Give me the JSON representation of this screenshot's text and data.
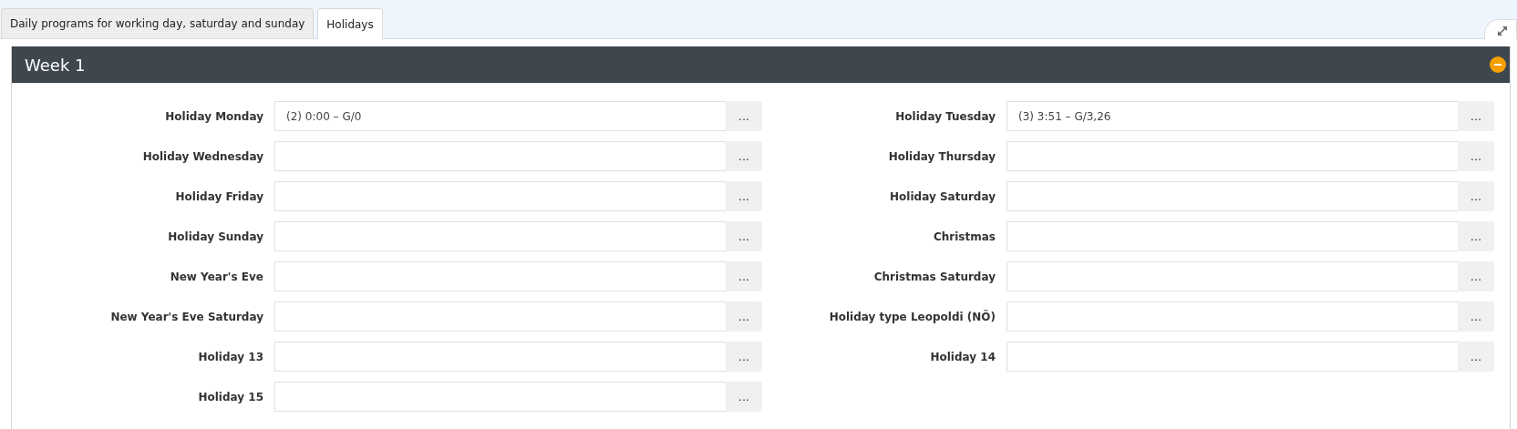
{
  "tabs": [
    {
      "label": "Daily programs for working day, saturday and sunday",
      "selected": false
    },
    {
      "label": "Holidays",
      "selected": true
    }
  ],
  "panel": {
    "title": "Week 1",
    "expanded": true,
    "fields": [
      {
        "label": "Holiday Monday",
        "value": "(2) 0:00 – G/0",
        "button": "..."
      },
      {
        "label": "Holiday Tuesday",
        "value": "(3) 3:51 – G/3,26",
        "button": "..."
      },
      {
        "label": "Holiday Wednesday",
        "button": "..."
      },
      {
        "label": "Holiday Thursday",
        "button": "..."
      },
      {
        "label": "Holiday Friday",
        "button": "..."
      },
      {
        "label": "Holiday Saturday",
        "button": "..."
      },
      {
        "label": "Holiday Sunday",
        "button": "..."
      },
      {
        "label": "Christmas",
        "button": "..."
      },
      {
        "label": "New Year's Eve",
        "button": "..."
      },
      {
        "label": "Christmas Saturday",
        "button": "..."
      },
      {
        "label": "New Year's Eve Saturday",
        "button": "..."
      },
      {
        "label": "Holiday type Leopoldi (NÖ)",
        "button": "..."
      },
      {
        "label": "Holiday 13",
        "button": "..."
      },
      {
        "label": "Holiday 14",
        "button": "..."
      },
      {
        "label": "Holiday 15",
        "button": "..."
      }
    ]
  }
}
